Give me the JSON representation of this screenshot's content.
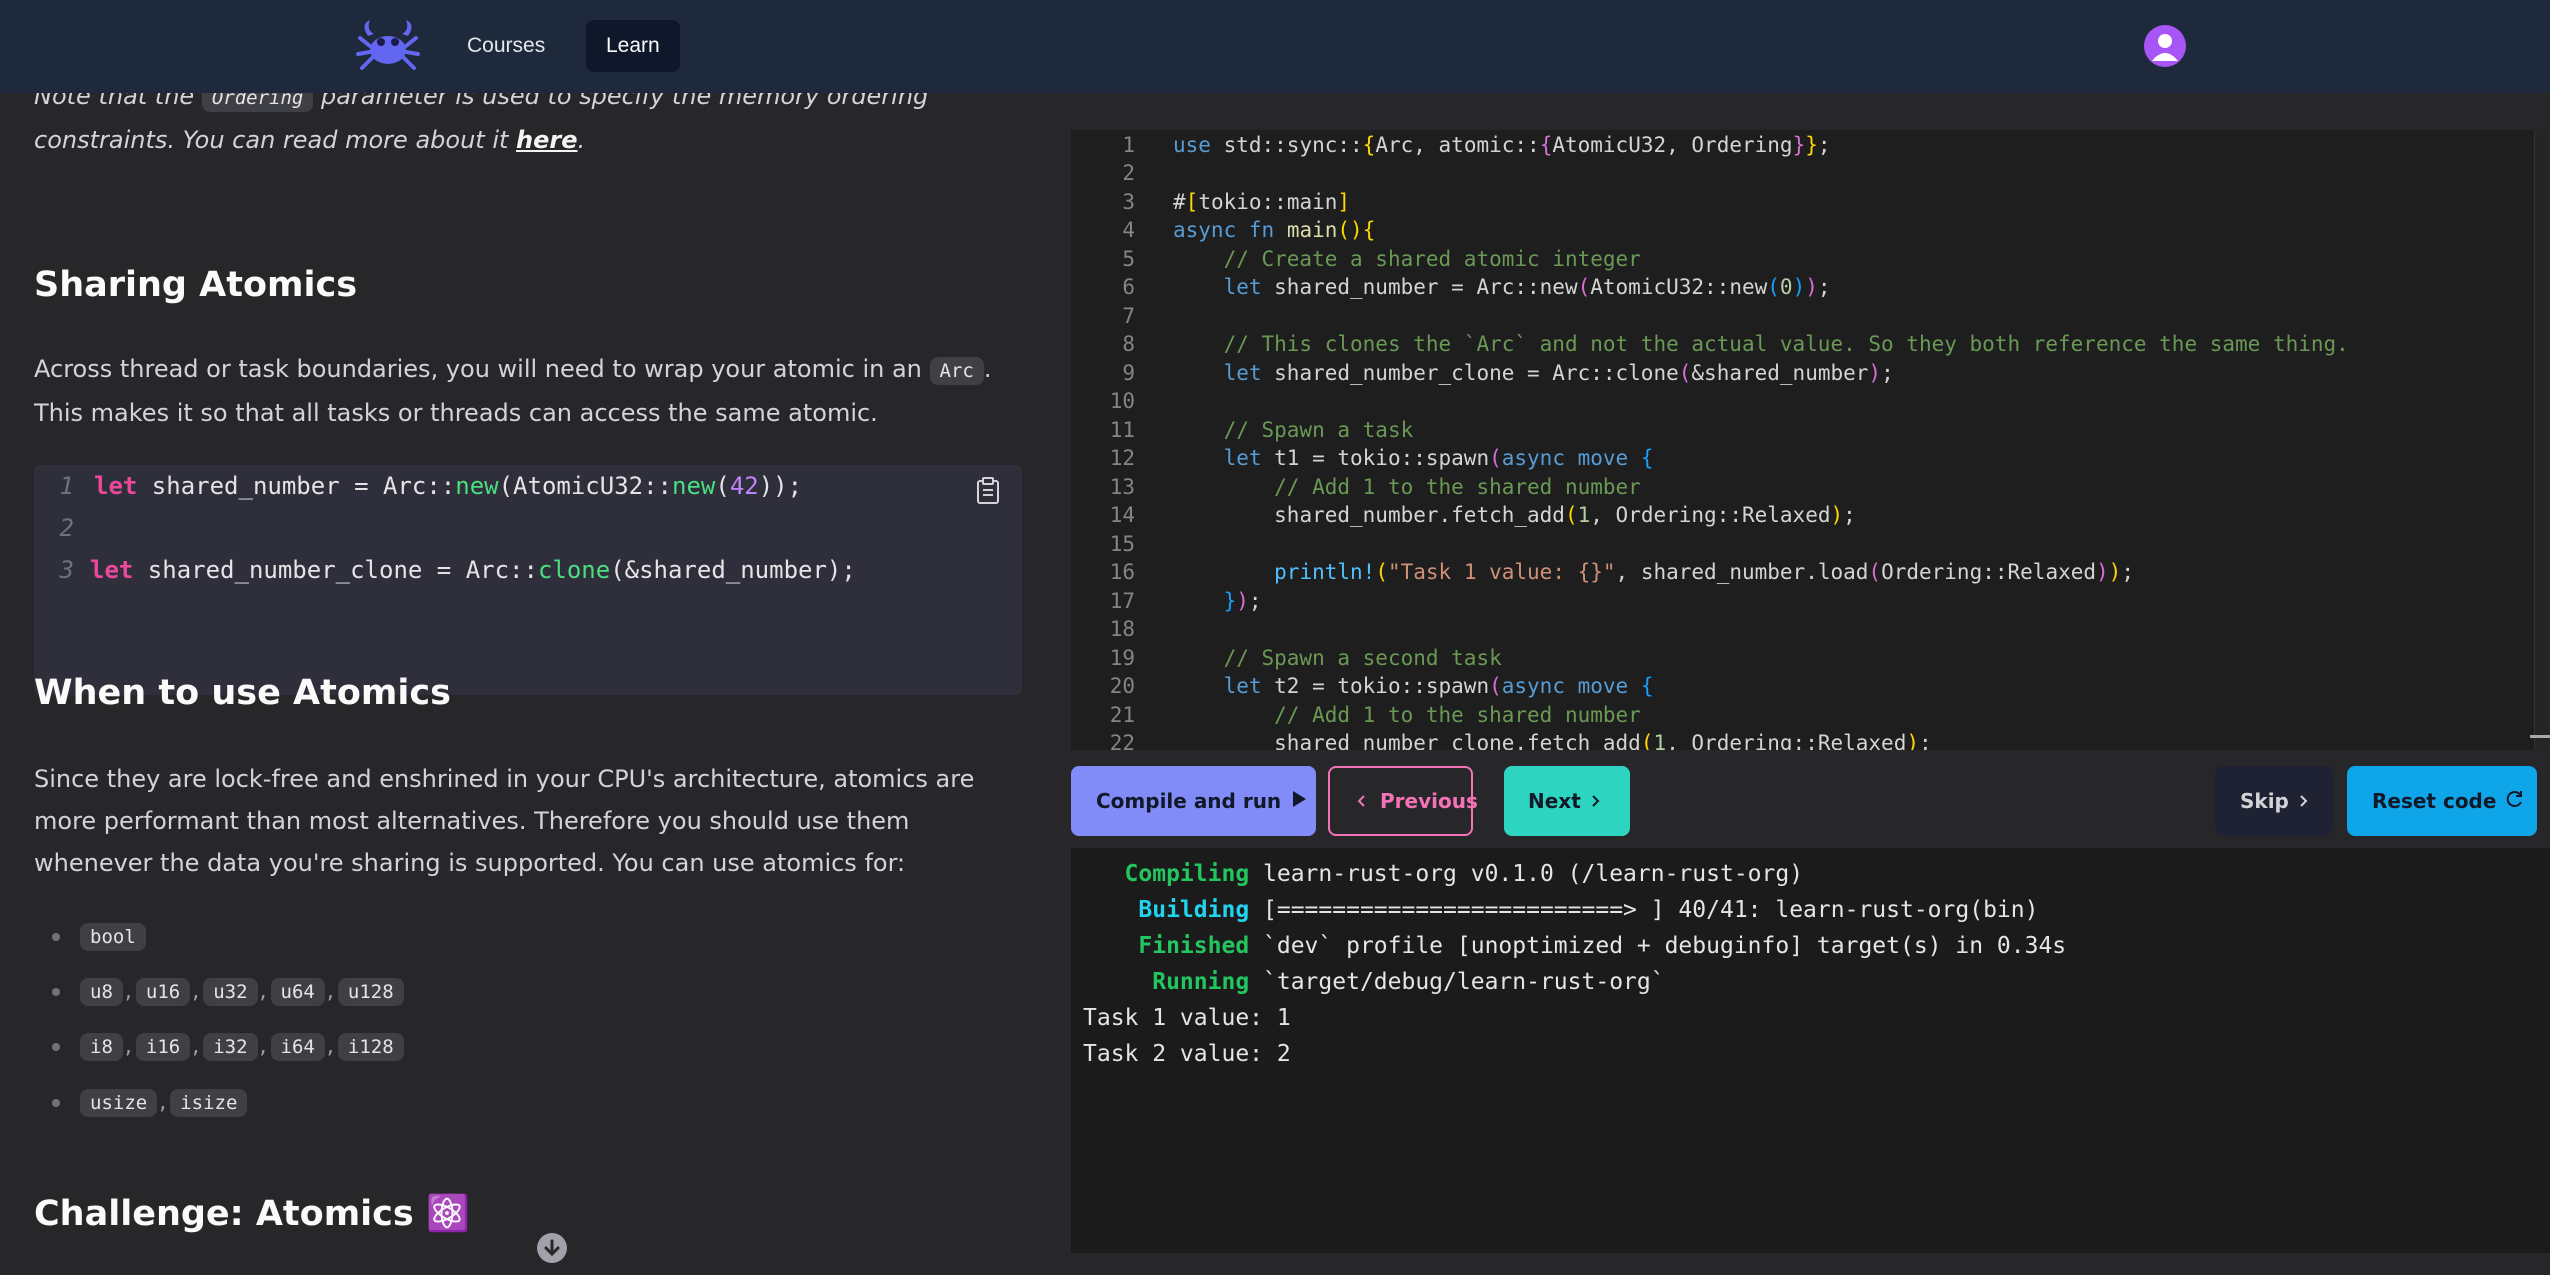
{
  "nav": {
    "courses": "Courses",
    "learn": "Learn",
    "logo_icon": "crab-logo-icon",
    "avatar_icon": "user-avatar-icon"
  },
  "article": {
    "intro": {
      "text_before": "Note that the ",
      "code": "Ordering",
      "text_after": " parameter is used to specify the memory ordering constraints. You can read more about it ",
      "link": "here",
      "end": "."
    },
    "sharing": {
      "heading": "Sharing Atomics",
      "text_before": "Across thread or task boundaries, you will need to wrap your atomic in an ",
      "code": "Arc",
      "text_after": ". This makes it so that all tasks or threads can access the same atomic."
    },
    "snippet": {
      "line_numbers": [
        "1",
        "2",
        "3"
      ],
      "line1": {
        "kw": "let",
        "a": " shared_number = Arc::",
        "fn1": "new",
        "b": "(AtomicU32::",
        "fn2": "new",
        "c": "(",
        "num": "42",
        "d": "));"
      },
      "line3": {
        "kw": "let",
        "a": " shared_number_clone = Arc::",
        "fn1": "clone",
        "b": "(&shared_number);"
      },
      "copy_icon": "clipboard-icon"
    },
    "when": {
      "heading": "When to use Atomics",
      "text": "Since they are lock-free and enshrined in your CPU's architecture, atomics are more performant than most alternatives. Therefore you should use them whenever the data you're sharing is supported. You can use atomics for:"
    },
    "types": [
      [
        "bool"
      ],
      [
        "u8",
        "u16",
        "u32",
        "u64",
        "u128"
      ],
      [
        "i8",
        "i16",
        "i32",
        "i64",
        "i128"
      ],
      [
        "usize",
        "isize"
      ]
    ],
    "challenge": {
      "heading": "Challenge: Atomics",
      "emoji": "⚛️"
    }
  },
  "editor": {
    "line_numbers": [
      "1",
      "2",
      "3",
      "4",
      "5",
      "6",
      "7",
      "8",
      "9",
      "10",
      "11",
      "12",
      "13",
      "14",
      "15",
      "16",
      "17",
      "18",
      "19",
      "20",
      "21",
      "22"
    ],
    "l1": {
      "use": "use",
      "a": " std::sync::",
      "b1": "{",
      "c": "Arc, atomic::",
      "b2": "{",
      "d": "AtomicU32, Ordering",
      "b3": "}",
      "b4": "}",
      "e": ";"
    },
    "l3": {
      "a": "#",
      "b1": "[",
      "c": "tokio::main",
      "b2": "]"
    },
    "l4": {
      "async": "async",
      "fn": "fn",
      "a": " main",
      "b1": "()",
      "b2": "{"
    },
    "l5": {
      "comment": "// Create a shared atomic integer"
    },
    "l6": {
      "let": "let",
      "a": " shared_number = Arc::new",
      "p1": "(",
      "b": "AtomicU32::new",
      "p2": "(",
      "n": "0",
      "p3": ")",
      "p4": ")",
      "e": ";"
    },
    "l8": {
      "comment": "// This clones the `Arc` and not the actual value. So they both reference the same thing."
    },
    "l9": {
      "let": "let",
      "a": " shared_number_clone = Arc::clone",
      "p1": "(",
      "b": "&shared_number",
      "p2": ")",
      "e": ";"
    },
    "l11": {
      "comment": "// Spawn a task"
    },
    "l12": {
      "let": "let",
      "a": " t1 = tokio::spawn",
      "p1": "(",
      "async": "async",
      "move": "move",
      "b": "{"
    },
    "l13": {
      "comment": "// Add 1 to the shared number"
    },
    "l14": {
      "a": "shared_number.fetch_add",
      "p1": "(",
      "n": "1",
      "b": ", Ordering::Relaxed",
      "p2": ")",
      "e": ";"
    },
    "l16": {
      "macro": "println!",
      "p1": "(",
      "str": "\"Task 1 value: {}\"",
      "a": ", shared_number.load",
      "p2": "(",
      "b": "Ordering::Relaxed",
      "p3": ")",
      "p4": ")",
      "e": ";"
    },
    "l17": {
      "b": "}",
      "p": ")",
      "e": ";"
    },
    "l19": {
      "comment": "// Spawn a second task"
    },
    "l20": {
      "let": "let",
      "a": " t2 = tokio::spawn",
      "p1": "(",
      "async": "async",
      "move": "move",
      "b": "{"
    },
    "l21": {
      "comment": "// Add 1 to the shared number"
    },
    "l22": {
      "a": "shared_number_clone.fetch_add",
      "p1": "(",
      "n": "1",
      "b": ", Ordering::Relaxed",
      "p2": ")",
      "e": ";"
    }
  },
  "toolbar": {
    "compile": "Compile and run",
    "previous": "Previous",
    "next": "Next",
    "skip": "Skip",
    "reset": "Reset code"
  },
  "terminal": {
    "lines": [
      {
        "label": "   Compiling",
        "text": " learn-rust-org v0.1.0 (/learn-rust-org)"
      },
      {
        "label": "    Building",
        "text": " [=========================> ] 40/41: learn-rust-org(bin)"
      },
      {
        "label": "    Finished",
        "text": " `dev` profile [unoptimized + debuginfo] target(s) in 0.34s"
      },
      {
        "label": "     Running",
        "text": " `target/debug/learn-rust-org`"
      }
    ],
    "output": [
      "Task 1 value: 1",
      "Task 2 value: 2"
    ]
  },
  "colors": {
    "nav_bg": "#1e293b",
    "compile": "#818cf8",
    "previous_border": "#f472b6",
    "next": "#2dd4bf",
    "reset": "#0ea5e9"
  }
}
